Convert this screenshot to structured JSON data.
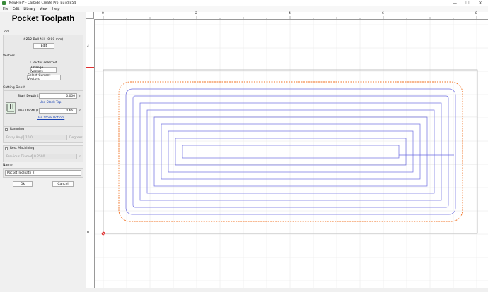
{
  "window": {
    "title": "[NewFile]* - Carbide Create Pro, Build 854",
    "controls": [
      "—",
      "☐",
      "✕"
    ]
  },
  "menu": {
    "items": [
      "File",
      "Edit",
      "Library",
      "View",
      "Help"
    ]
  },
  "panel": {
    "title": "Pocket Toolpath",
    "tool": {
      "section": "Tool",
      "name": "#212 Ball Mill (0.00 mm)",
      "edit_label": "Edit"
    },
    "vectors": {
      "section": "Vectors",
      "selected_text": "1 Vector selected",
      "change_label": "Change Vectors",
      "select_current_label": "Select Current Vectors"
    },
    "cutting_depth": {
      "section": "Cutting Depth",
      "start_label": "Start Depth (S)",
      "start_value": "0.000",
      "start_unit": "in",
      "use_stock_top": "Use Stock Top",
      "max_label": "Max Depth (D)",
      "max_value": "0.661",
      "max_unit": "in",
      "use_stock_bottom": "Use Stock Bottom"
    },
    "ramping": {
      "label": "Ramping",
      "entry_angle_label": "Entry Angle",
      "entry_angle_value": "10.0",
      "entry_angle_unit": "Degrees"
    },
    "rest_machining": {
      "label": "Rest Machining",
      "prev_diameter_label": "Previous Diameter",
      "prev_diameter_value": "0.2500",
      "prev_diameter_unit": "in"
    },
    "name": {
      "section": "Name",
      "value": "Pocket Toolpath 2"
    },
    "ok_label": "Ok",
    "cancel_label": "Cancel"
  },
  "ruler": {
    "top_labels": [
      "0",
      "2",
      "4",
      "6",
      "8"
    ],
    "left_labels": [
      "4",
      "0"
    ]
  },
  "colors": {
    "toolpath": "#6e6ee0",
    "boundary": "#f07020",
    "stock_border": "#b0b0b0",
    "grid": "#e4e4e4",
    "origin": "#e03030"
  }
}
